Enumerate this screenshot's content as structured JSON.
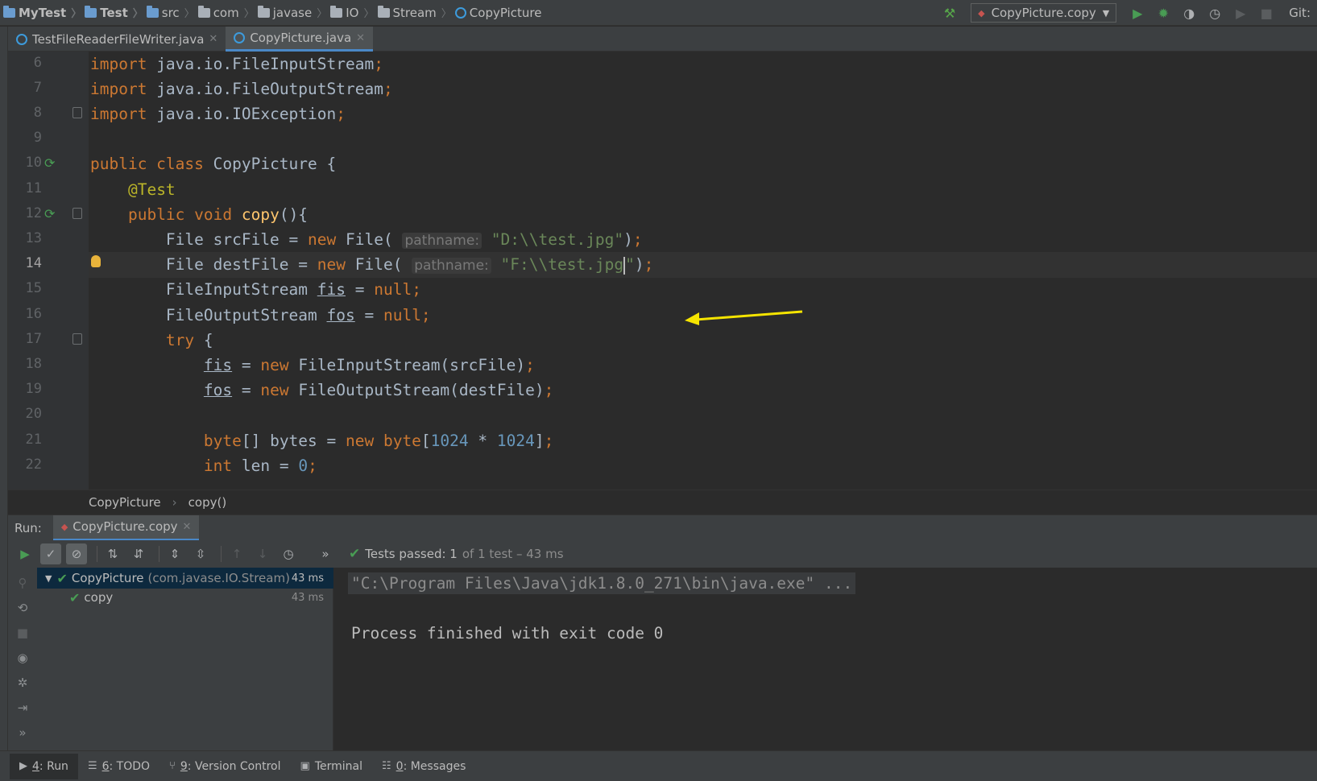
{
  "navbar": {
    "crumbs": [
      "MyTest",
      "Test",
      "src",
      "com",
      "javase",
      "IO",
      "Stream",
      "CopyPicture"
    ],
    "run_config": "CopyPicture.copy",
    "git_label": "Git:"
  },
  "editor_tabs": [
    {
      "label": "TestFileReaderFileWriter.java",
      "active": false
    },
    {
      "label": "CopyPicture.java",
      "active": true
    }
  ],
  "editor": {
    "line_numbers": [
      "6",
      "7",
      "8",
      "9",
      "10",
      "11",
      "12",
      "13",
      "14",
      "15",
      "16",
      "17",
      "18",
      "19",
      "20",
      "21",
      "22"
    ],
    "lines": [
      "import java.io.FileInputStream;",
      "import java.io.FileOutputStream;",
      "import java.io.IOException;",
      "",
      "public class CopyPicture {",
      "    @Test",
      "    public void copy(){",
      "        File srcFile = new File( pathname: \"D:\\\\test.jpg\");",
      "        File destFile = new File( pathname: \"F:\\\\test.jpg\");",
      "        FileInputStream fis = null;",
      "        FileOutputStream fos = null;",
      "        try {",
      "            fis = new FileInputStream(srcFile);",
      "            fos = new FileOutputStream(destFile);",
      "",
      "            byte[] bytes = new byte[1024 * 1024];",
      "            int len = 0;"
    ],
    "current_line": "14"
  },
  "breadcrumb": {
    "class": "CopyPicture",
    "method": "copy()"
  },
  "run_panel": {
    "label": "Run:",
    "tab": "CopyPicture.copy",
    "tests_passed_main": "Tests passed: 1",
    "tests_passed_sub": "of 1 test – 43 ms",
    "tree": [
      {
        "name": "CopyPicture",
        "pkg": "(com.javase.IO.Stream)",
        "time": "43 ms"
      },
      {
        "name": "copy",
        "pkg": "",
        "time": "43 ms"
      }
    ],
    "console": {
      "command": "\"C:\\Program Files\\Java\\jdk1.8.0_271\\bin\\java.exe\" ...",
      "exit": "Process finished with exit code 0"
    }
  },
  "bottom_tabs": [
    {
      "prefix": "4",
      "label": ": Run",
      "icon": "play-icon"
    },
    {
      "prefix": "6",
      "label": ": TODO",
      "icon": "list-icon"
    },
    {
      "prefix": "9",
      "label": ": Version Control",
      "icon": "vcs-icon"
    },
    {
      "prefix": "",
      "label": "Terminal",
      "icon": "terminal-icon"
    },
    {
      "prefix": "0",
      "label": ": Messages",
      "icon": "messages-icon"
    }
  ],
  "colors": {
    "accent": "#4a88c7",
    "pass_green": "#499c54",
    "keyword": "#cc7832",
    "string": "#6a8759",
    "arrow": "#f5e400"
  }
}
